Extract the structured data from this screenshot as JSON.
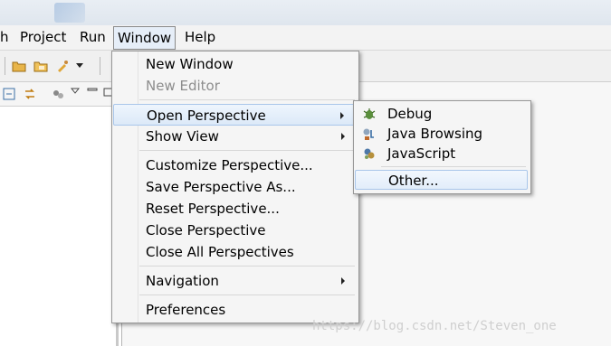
{
  "menubar": {
    "items": [
      "h",
      "Project",
      "Run",
      "Window",
      "Help"
    ]
  },
  "window_menu": {
    "items": [
      {
        "label": "New Window"
      },
      {
        "label": "New Editor",
        "disabled": true
      },
      {
        "label": "Open Perspective",
        "submenu": true,
        "highlighted": true
      },
      {
        "label": "Show View",
        "submenu": true
      },
      {
        "label": "Customize Perspective..."
      },
      {
        "label": "Save Perspective As..."
      },
      {
        "label": "Reset Perspective..."
      },
      {
        "label": "Close Perspective"
      },
      {
        "label": "Close All Perspectives"
      },
      {
        "label": "Navigation",
        "submenu": true
      },
      {
        "label": "Preferences"
      }
    ]
  },
  "perspective_submenu": {
    "items": [
      {
        "label": "Debug",
        "icon": "debug-icon"
      },
      {
        "label": "Java Browsing",
        "icon": "java-browsing-icon"
      },
      {
        "label": "JavaScript",
        "icon": "javascript-icon"
      },
      {
        "label": "Other...",
        "highlighted": true
      }
    ]
  },
  "watermark": "https://blog.csdn.net/Steven_one"
}
